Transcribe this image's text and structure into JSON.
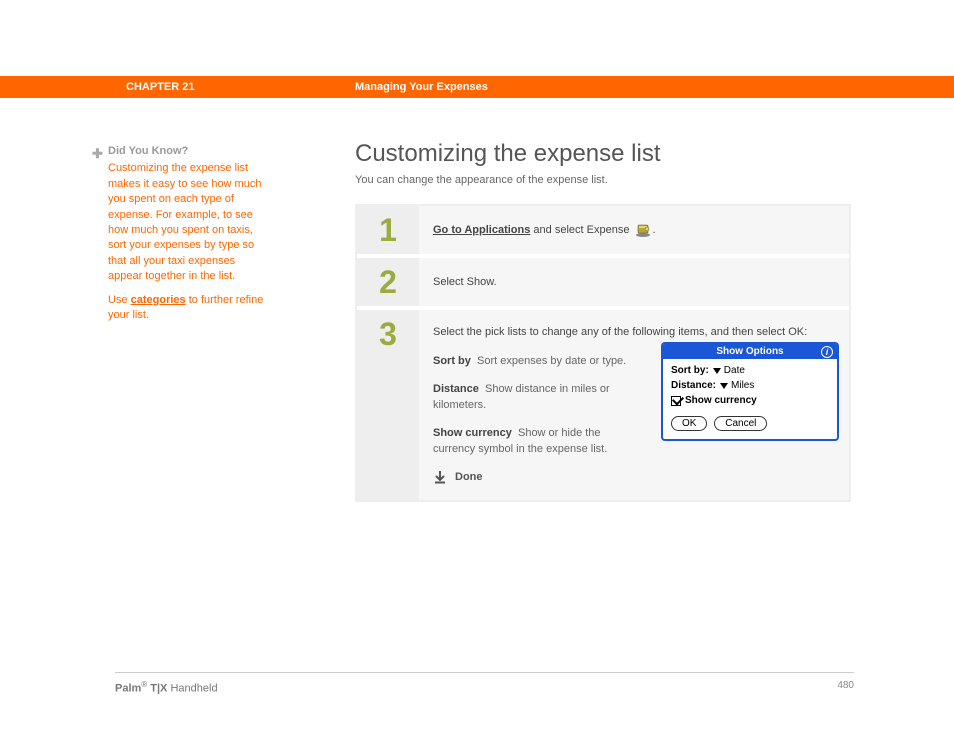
{
  "header": {
    "chapter": "CHAPTER 21",
    "subject": "Managing Your Expenses"
  },
  "sidebar": {
    "did_you_know_label": "Did You Know?",
    "body1": "Customizing the expense list makes it easy to see how much you spent on each type of expense. For example, to see how much you spent on taxis, sort your expenses by type so that all your taxi expenses appear together in the list.",
    "body2_pre": "Use ",
    "body2_link": "categories",
    "body2_post": " to further refine your list."
  },
  "main": {
    "title": "Customizing the expense list",
    "intro": "You can change the appearance of the expense list."
  },
  "steps": {
    "s1": {
      "num": "1",
      "link": "Go to Applications",
      "suffix": " and select Expense ",
      "period": "."
    },
    "s2": {
      "num": "2",
      "text": "Select Show."
    },
    "s3": {
      "num": "3",
      "lead": "Select the pick lists to change any of the following items, and then select OK:",
      "def1_key": "Sort by",
      "def1_desc": "Sort expenses by date or type.",
      "def2_key": "Distance",
      "def2_desc": "Show distance in miles or kilometers.",
      "def3_key": "Show currency",
      "def3_desc": "Show or hide the currency symbol in the expense list.",
      "done": "Done"
    }
  },
  "dialog": {
    "title": "Show Options",
    "row1_label": "Sort by:",
    "row1_value": "Date",
    "row2_label": "Distance:",
    "row2_value": "Miles",
    "row3_label": "Show currency",
    "ok": "OK",
    "cancel": "Cancel"
  },
  "footer": {
    "brand1": "Palm",
    "reg": "®",
    "brand2": " T|X",
    "tail": " Handheld",
    "page": "480"
  }
}
